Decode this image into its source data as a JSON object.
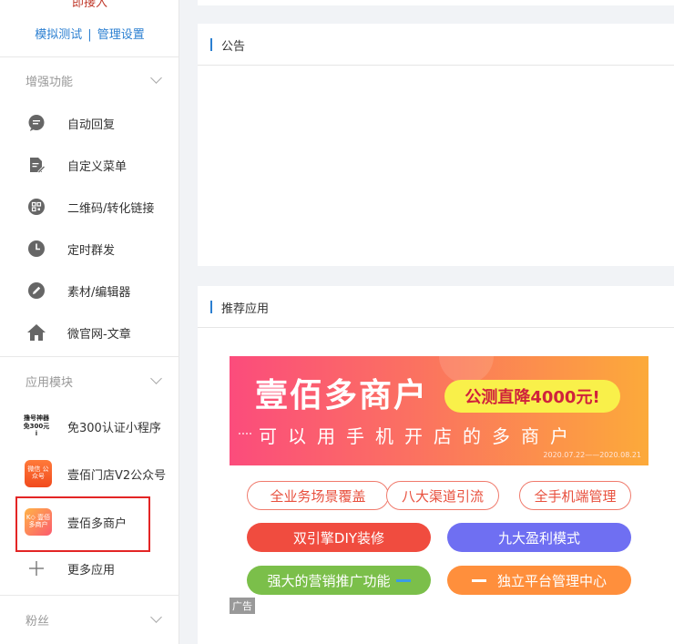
{
  "sidebar": {
    "top_cut_text": "即接入",
    "mode_links": {
      "test": "模拟测试",
      "separator": "|",
      "settings": "管理设置"
    },
    "sections": [
      {
        "title": "增强功能",
        "items": [
          {
            "label": "自动回复",
            "icon": "chat-bubble-icon"
          },
          {
            "label": "自定义菜单",
            "icon": "document-edit-icon"
          },
          {
            "label": "二维码/转化链接",
            "icon": "qrcode-icon"
          },
          {
            "label": "定时群发",
            "icon": "clock-icon"
          },
          {
            "label": "素材/编辑器",
            "icon": "pencil-icon"
          },
          {
            "label": "微官网-文章",
            "icon": "home-icon"
          }
        ]
      },
      {
        "title": "应用模块",
        "items": [
          {
            "label": "免300认证小程序",
            "thumb_text": "撸号神器 免300元i"
          },
          {
            "label": "壹佰门店V2公众号",
            "thumb_text": "微信 公众号"
          },
          {
            "label": "壹佰多商户",
            "thumb_text": "K◇ 壹佰多商户"
          },
          {
            "label": "更多应用",
            "icon": "plus-icon"
          }
        ]
      },
      {
        "title": "粉丝"
      }
    ]
  },
  "main": {
    "notice": {
      "title": "公告"
    },
    "recommended": {
      "title": "推荐应用",
      "banner": {
        "headline": "壹佰多商户",
        "pill": "公测直降4000元!",
        "subline": "可以用手机开店的多商户",
        "dates": "2020.07.22——2020.08.21"
      },
      "tags": [
        "全业务场景覆盖",
        "八大渠道引流",
        "全手机端管理",
        "双引擎DIY装修",
        "九大盈利模式",
        "强大的营销推广功能",
        "独立平台管理中心"
      ],
      "ad_label": "广告"
    }
  },
  "colors": {
    "accent": "#2b7fd1",
    "highlight_border": "#e32525",
    "tag_red": "#f04c3f",
    "tag_purple": "#6f6ff2",
    "tag_green": "#7bbf4a",
    "tag_orange": "#ff8f3c"
  }
}
